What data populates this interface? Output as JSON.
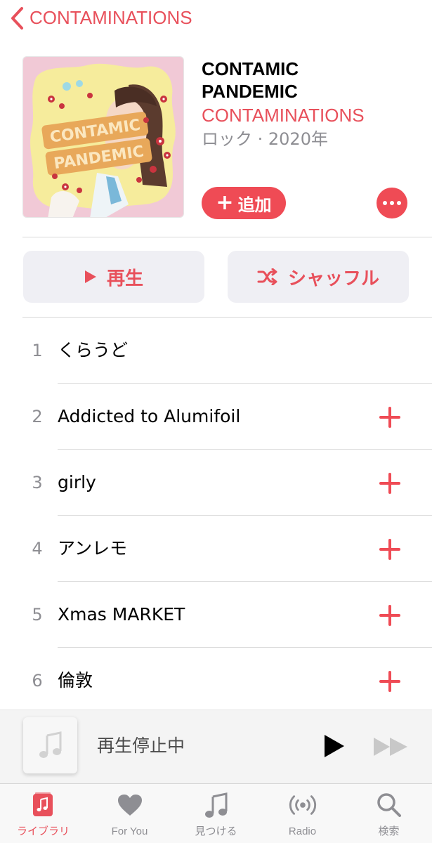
{
  "nav": {
    "back_label": "CONTAMINATIONS"
  },
  "album": {
    "title_line1": "CONTAMIC",
    "title_line2": "PANDEMIC",
    "artist": "CONTAMINATIONS",
    "meta": "ロック · 2020年",
    "add_label": "追加",
    "artwork_icon": "album-artwork-illustration"
  },
  "actions": {
    "play_label": "再生",
    "shuffle_label": "シャッフル"
  },
  "tracks": [
    {
      "num": "1",
      "title": "くらうど",
      "addable": false
    },
    {
      "num": "2",
      "title": "Addicted to Alumifoil",
      "addable": true
    },
    {
      "num": "3",
      "title": "girly",
      "addable": true
    },
    {
      "num": "4",
      "title": "アンレモ",
      "addable": true
    },
    {
      "num": "5",
      "title": "Xmas MARKET",
      "addable": true
    },
    {
      "num": "6",
      "title": "倫敦",
      "addable": true
    }
  ],
  "mini_player": {
    "status": "再生停止中",
    "artwork_icon": "music-note-icon"
  },
  "tabbar": [
    {
      "label": "ライブラリ",
      "icon": "library-icon",
      "active": true
    },
    {
      "label": "For You",
      "icon": "heart-icon",
      "active": false
    },
    {
      "label": "見つける",
      "icon": "music-note-icon",
      "active": false
    },
    {
      "label": "Radio",
      "icon": "radio-icon",
      "active": false
    },
    {
      "label": "検索",
      "icon": "search-icon",
      "active": false
    }
  ],
  "colors": {
    "accent": "#e8505b",
    "accent_button": "#ef4b55",
    "secondary_text": "#8e8e93",
    "button_bg": "#efeff4"
  }
}
